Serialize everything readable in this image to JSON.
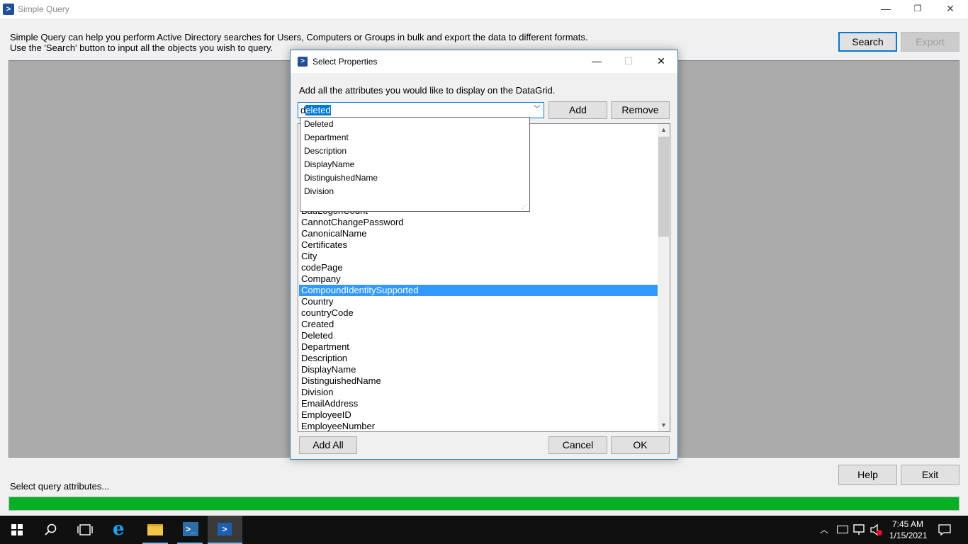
{
  "window": {
    "title": "Simple Query",
    "minimize": "—",
    "restore": "❐",
    "close": "✕"
  },
  "intro": {
    "line1": "Simple Query can help you perform Active Directory searches for Users, Computers or Groups in bulk and export the data to different formats.",
    "line2": "Use the 'Search' button to input all the objects you wish to query."
  },
  "buttons": {
    "search": "Search",
    "export": "Export",
    "help": "Help",
    "exit": "Exit"
  },
  "status": {
    "text": "Select query attributes...",
    "progress": 1.0
  },
  "dialog": {
    "title": "Select Properties",
    "hint": "Add all the attributes you would like to display on the DataGrid.",
    "combo_prefix": "d",
    "combo_selected": "eleted",
    "add": "Add",
    "remove": "Remove",
    "add_all": "Add All",
    "cancel": "Cancel",
    "ok": "OK",
    "dropdown_items": [
      "Deleted",
      "Department",
      "Description",
      "DisplayName",
      "DistinguishedName",
      "Division"
    ],
    "list_partial_item": "BadLogonCount",
    "list_items": [
      "CannotChangePassword",
      "CanonicalName",
      "Certificates",
      "City",
      "codePage",
      "Company",
      "CompoundIdentitySupported",
      "Country",
      "countryCode",
      "Created",
      "Deleted",
      "Department",
      "Description",
      "DisplayName",
      "DistinguishedName",
      "Division",
      "EmailAddress",
      "EmployeeID",
      "EmployeeNumber"
    ],
    "selected_item": "CompoundIdentitySupported"
  },
  "taskbar": {
    "time": "7:45 AM",
    "date": "1/15/2021"
  },
  "colors": {
    "accent": "#0078d7",
    "progress": "#06b025",
    "selection": "#3399ff",
    "taskbar": "#101010"
  }
}
